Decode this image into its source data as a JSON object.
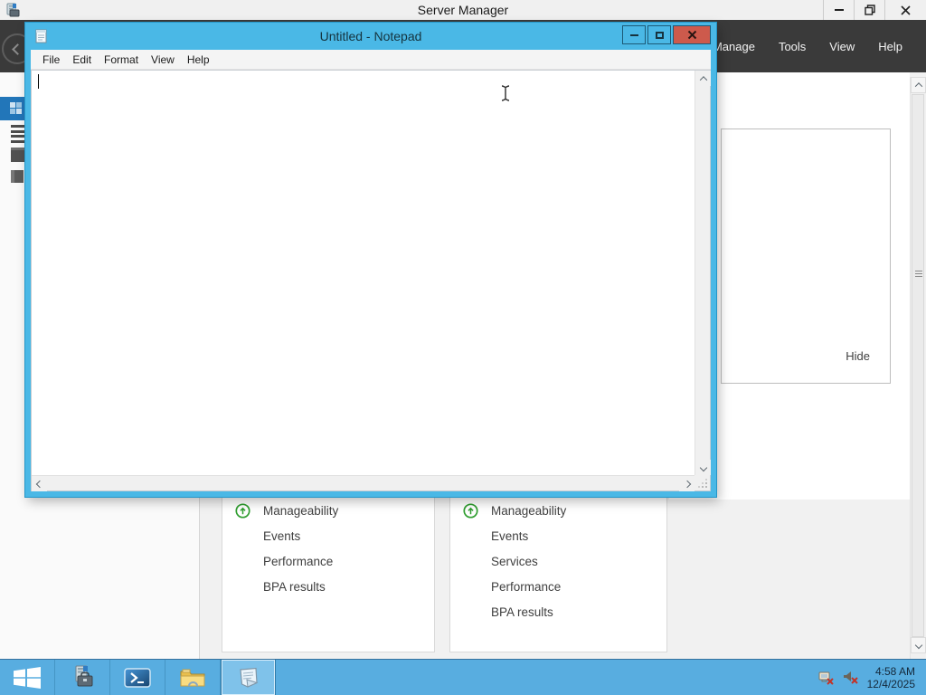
{
  "colors": {
    "taskbar_blue": "#58ade0",
    "window_chrome_cyan": "#4ab8e6",
    "close_button_red": "#cd5a4c",
    "header_dark_gray": "#3a3a3a",
    "nav_selected_blue": "#2276b9",
    "status_green": "#2f9e2f"
  },
  "server_manager": {
    "title": "Server Manager",
    "header_menu": [
      {
        "label": "Manage"
      },
      {
        "label": "Tools"
      },
      {
        "label": "View"
      },
      {
        "label": "Help"
      }
    ],
    "hide_label": "Hide",
    "tiles": [
      {
        "rows": [
          "Manageability",
          "Events",
          "Performance",
          "BPA results"
        ]
      },
      {
        "rows": [
          "Manageability",
          "Events",
          "Services",
          "Performance",
          "BPA results"
        ]
      }
    ]
  },
  "notepad": {
    "title": "Untitled - Notepad",
    "menu": [
      {
        "label": "File"
      },
      {
        "label": "Edit"
      },
      {
        "label": "Format"
      },
      {
        "label": "View"
      },
      {
        "label": "Help"
      }
    ],
    "content": ""
  },
  "taskbar": {
    "clock": {
      "time": "4:58 AM",
      "date": "12/4/2025"
    }
  }
}
